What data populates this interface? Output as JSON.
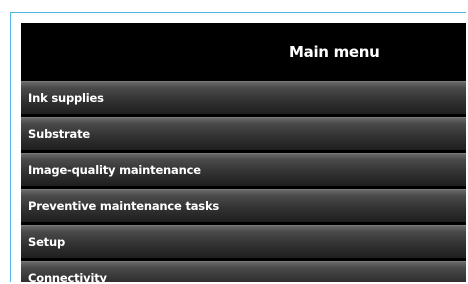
{
  "header": {
    "title": "Main menu"
  },
  "menu": {
    "items": [
      {
        "label": "Ink supplies"
      },
      {
        "label": "Substrate"
      },
      {
        "label": "Image-quality  maintenance"
      },
      {
        "label": "Preventive maintenance tasks"
      },
      {
        "label": "Setup"
      },
      {
        "label": "Connectivity"
      }
    ]
  },
  "colors": {
    "frame_border": "#4fb3e6",
    "screen_background": "#000000",
    "text": "#ffffff"
  }
}
